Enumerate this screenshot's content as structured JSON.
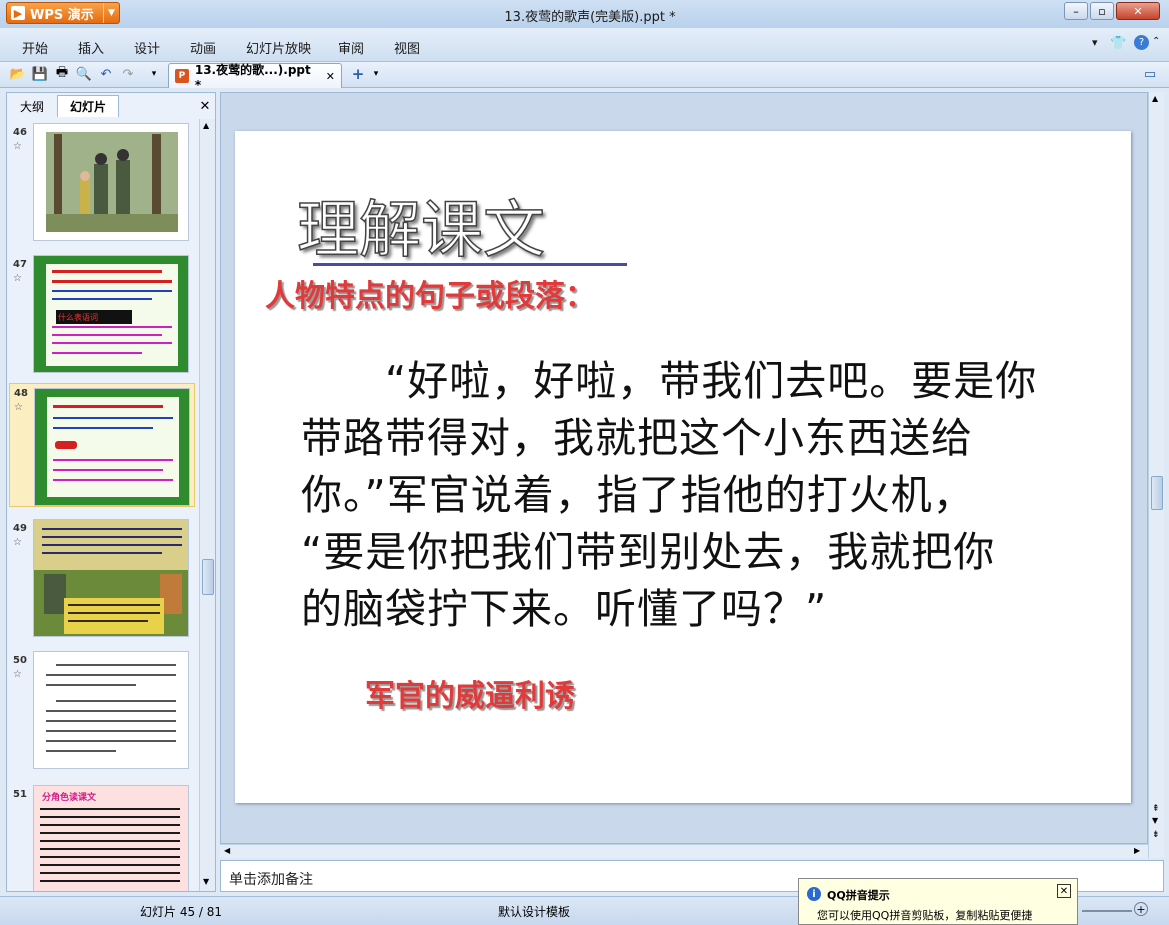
{
  "app": {
    "name": "WPS 演示",
    "window_title": "13.夜莺的歌声(完美版).ppt *"
  },
  "menu": [
    "开始",
    "插入",
    "设计",
    "动画",
    "幻灯片放映",
    "审阅",
    "视图"
  ],
  "doc_tab": {
    "label": "13.夜莺的歌...).ppt *"
  },
  "left_panel": {
    "tabs": [
      "大纲",
      "幻灯片"
    ],
    "thumbnails": [
      {
        "num": "46",
        "caption": ""
      },
      {
        "num": "47",
        "caption": "什么表语词"
      },
      {
        "num": "48",
        "caption": ""
      },
      {
        "num": "49",
        "caption": ""
      },
      {
        "num": "50",
        "caption": ""
      },
      {
        "num": "51",
        "caption": "分角色读课文"
      }
    ],
    "selected": "48"
  },
  "slide": {
    "title": "理解课文",
    "subtitle": "人物特点的句子或段落：",
    "quote_lines": [
      "　　“好啦，好啦，带我们去吧。要是你",
      "带路带得对，我就把这个小东西送给",
      "你。”军官说着，指了指他的打火机，",
      "“要是你把我们带到别处去，我就把你",
      "的脑袋拧下来。听懂了吗？”"
    ],
    "note": "军官的威逼利诱"
  },
  "notes_placeholder": "单击添加备注",
  "status": {
    "slide_counter": "幻灯片 45 / 81",
    "template": "默认设计模板"
  },
  "qq_tip": {
    "title": "QQ拼音提示",
    "body": "您可以使用QQ拼音剪贴板，复制粘贴更便捷"
  },
  "colors": {
    "accent_red": "#e23a3a",
    "title_underline": "#4a4aa8",
    "wps_orange": "#e56b10"
  }
}
